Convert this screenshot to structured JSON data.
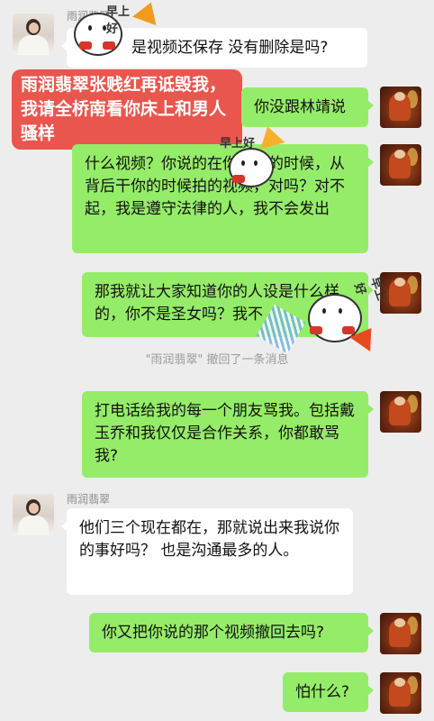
{
  "contact_name": "雨润翡翠",
  "messages": [
    {
      "side": "left",
      "text": "是视频还保存 没有删除是吗?"
    },
    {
      "side": "right",
      "text": "你没跟林靖说"
    },
    {
      "side": "right",
      "text": "什么视频？你说的在你干你的时候，从背后干你的时候拍的视频，对吗？对不起，我是遵守法律的人，我不会发出"
    },
    {
      "side": "right",
      "text": "那我就让大家知道你的人设是什么样的，你不是圣女吗？我不"
    },
    {
      "side": "right",
      "text": "打电话给我的每一个朋友骂我。包括戴玉乔和我仅仅是合作关系，你都敢骂我?"
    },
    {
      "side": "left",
      "text": "他们三个现在都在，那就说出来我说你的事好吗？  也是沟通最多的人。"
    },
    {
      "side": "right",
      "text": "你又把你说的那个视频撤回去吗?"
    },
    {
      "side": "right",
      "text": "怕什么?"
    }
  ],
  "system_notice": "\"雨润翡翠\" 撤回了一条消息",
  "overlay_caption": "雨润翡翠张贱红再诋毁我，我请全桥南看你床上和男人骚样",
  "sticker_text": "早上好",
  "colors": {
    "bg": "#ededed",
    "right_bubble": "#95ec69",
    "left_bubble": "#ffffff",
    "overlay": "#e8564e"
  }
}
